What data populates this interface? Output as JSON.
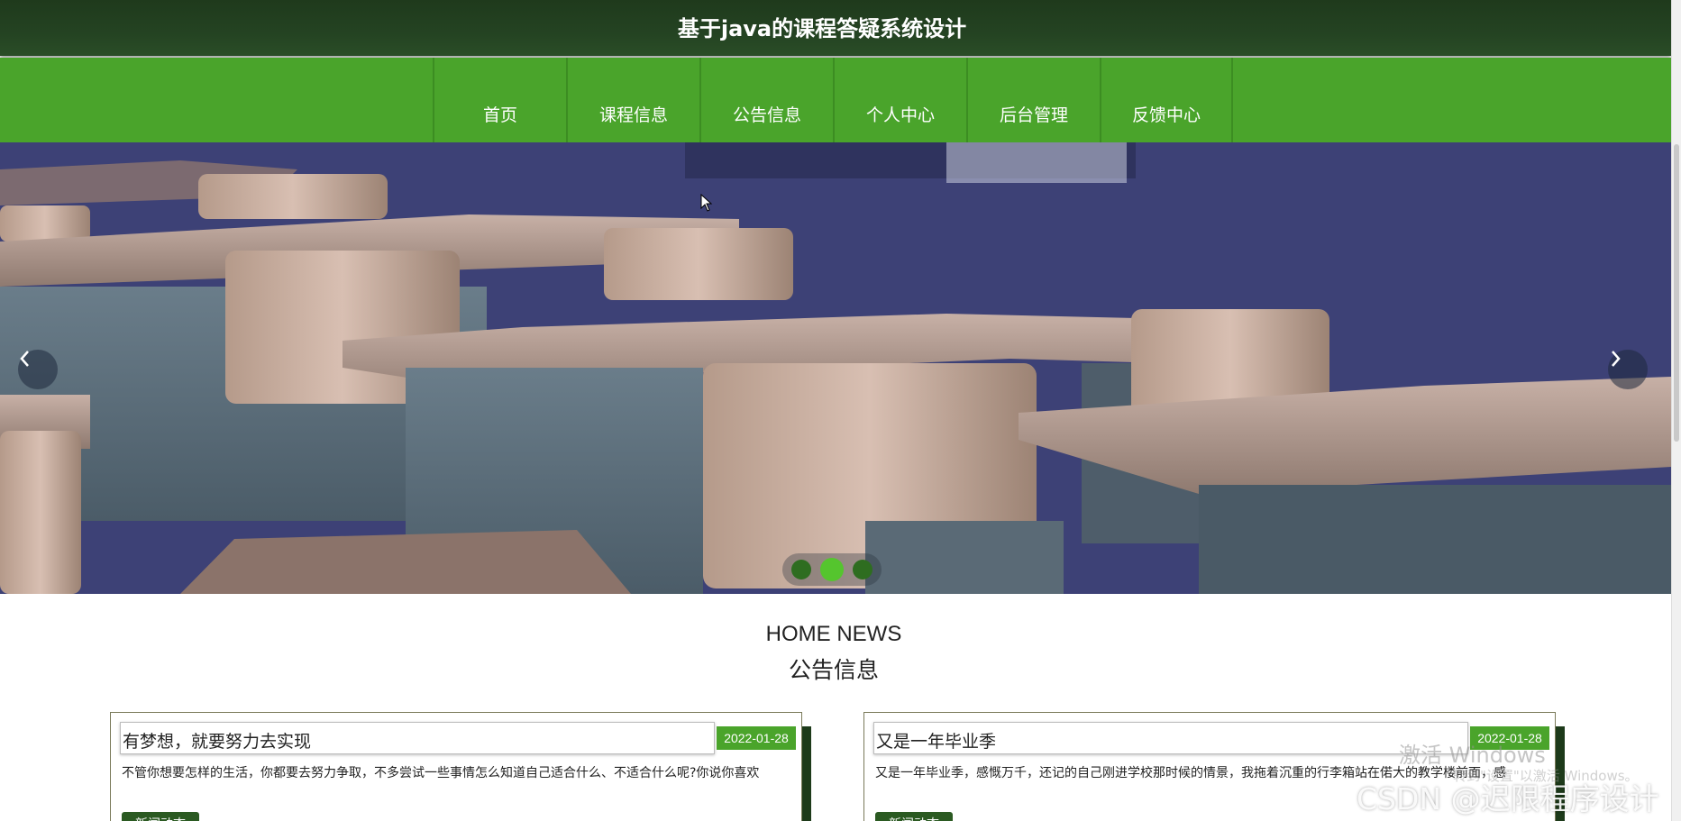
{
  "header": {
    "title": "基于java的课程答疑系统设计"
  },
  "nav": {
    "items": [
      {
        "label": "首页"
      },
      {
        "label": "课程信息"
      },
      {
        "label": "公告信息"
      },
      {
        "label": "个人中心"
      },
      {
        "label": "后台管理"
      },
      {
        "label": "反馈中心"
      }
    ]
  },
  "carousel": {
    "slide_count": 3,
    "active_index": 1,
    "prev_icon": "chevron-left-icon",
    "next_icon": "chevron-right-icon"
  },
  "news": {
    "heading_en": "HOME NEWS",
    "heading_cn": "公告信息",
    "items": [
      {
        "title": "有梦想，就要努力去实现",
        "date": "2022-01-28",
        "excerpt": "不管你想要怎样的生活，你都要去努力争取，不多尝试一些事情怎么知道自己适合什么、不适合什么呢?你说你喜欢",
        "tag": "新闻动态"
      },
      {
        "title": "又是一年毕业季",
        "date": "2022-01-28",
        "excerpt": "又是一年毕业季，感慨万千，还记的自己刚进学校那时候的情景，我拖着沉重的行李箱站在偌大的教学楼前面，感",
        "tag": "新闻动态"
      }
    ]
  },
  "watermarks": {
    "windows": "激活 Windows",
    "windows_sub": "转到\"设置\"以激活 Windows。",
    "csdn": "CSDN @迟限程序设计"
  },
  "colors": {
    "header": "#244322",
    "nav": "#4aa42b",
    "accent": "#4aa42b",
    "tag": "#2b5a22"
  }
}
